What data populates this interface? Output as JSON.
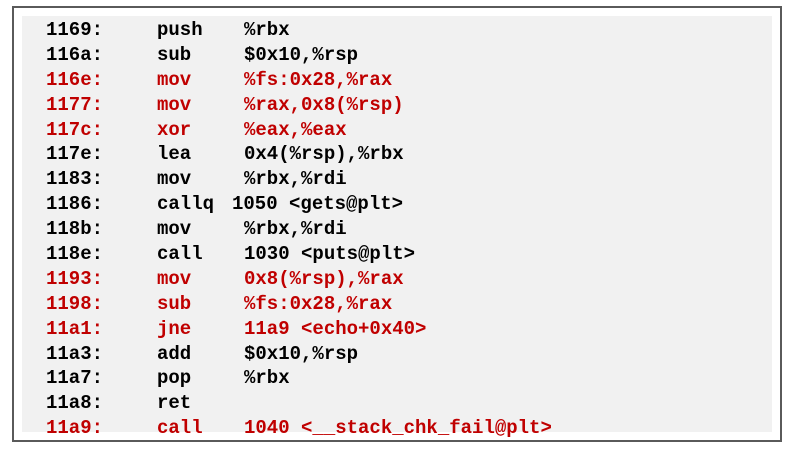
{
  "listing": {
    "highlight_color": "#c00000",
    "text_color": "#000000",
    "rows": [
      {
        "addr": "1169:",
        "op": "push",
        "args": "%rbx",
        "highlight": false
      },
      {
        "addr": "116a:",
        "op": "sub",
        "args": "$0x10,%rsp",
        "highlight": false
      },
      {
        "addr": "116e:",
        "op": "mov",
        "args": "%fs:0x28,%rax",
        "highlight": true
      },
      {
        "addr": "1177:",
        "op": "mov",
        "args": "%rax,0x8(%rsp)",
        "highlight": true
      },
      {
        "addr": "117c:",
        "op": "xor",
        "args": "%eax,%eax",
        "highlight": true
      },
      {
        "addr": "117e:",
        "op": "lea",
        "args": "0x4(%rsp),%rbx",
        "highlight": false
      },
      {
        "addr": "1183:",
        "op": "mov",
        "args": "%rbx,%rdi",
        "highlight": false
      },
      {
        "addr": "1186:",
        "op": "callq",
        "args": "1050 <gets@plt>",
        "highlight": false
      },
      {
        "addr": "118b:",
        "op": "mov",
        "args": "%rbx,%rdi",
        "highlight": false
      },
      {
        "addr": "118e:",
        "op": "call",
        "args": "1030 <puts@plt>",
        "highlight": false
      },
      {
        "addr": "1193:",
        "op": "mov",
        "args": "0x8(%rsp),%rax",
        "highlight": true
      },
      {
        "addr": "1198:",
        "op": "sub",
        "args": "%fs:0x28,%rax",
        "highlight": true
      },
      {
        "addr": "11a1:",
        "op": "jne",
        "args": "11a9 <echo+0x40>",
        "highlight": true
      },
      {
        "addr": "11a3:",
        "op": "add",
        "args": "$0x10,%rsp",
        "highlight": false
      },
      {
        "addr": "11a7:",
        "op": "pop",
        "args": "%rbx",
        "highlight": false
      },
      {
        "addr": "11a8:",
        "op": "ret",
        "args": "",
        "highlight": false
      },
      {
        "addr": "11a9:",
        "op": "call",
        "args": "1040 <__stack_chk_fail@plt>",
        "highlight": true
      }
    ]
  }
}
